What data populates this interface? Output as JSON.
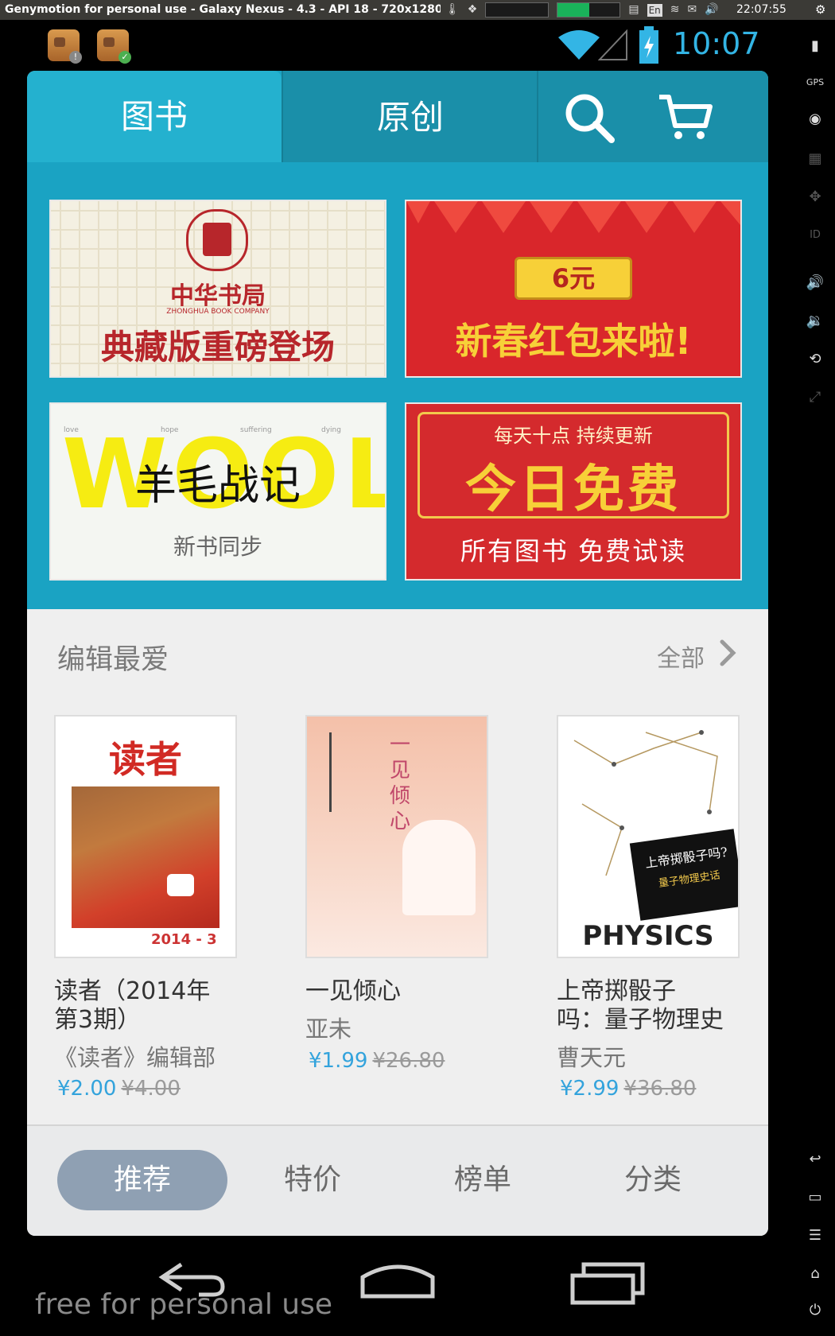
{
  "host": {
    "window_title": "Genymotion for personal use - Galaxy Nexus - 4.3 - API 18 - 720x1280 (720x128",
    "keyboard_layout": "En",
    "time": "22:07:55"
  },
  "status_bar": {
    "clock": "10:07",
    "accent_color": "#33b5e5"
  },
  "app": {
    "tabs": [
      {
        "label": "图书"
      },
      {
        "label": "原创"
      }
    ],
    "icons": {
      "search": "search-icon",
      "cart": "cart-icon"
    },
    "banners": {
      "zhonghua": {
        "logo": "中华书局",
        "logo_en": "ZHONGHUA BOOK COMPANY",
        "headline": "典藏版重磅登场"
      },
      "redpacket": {
        "ticket": "6元",
        "headline": "新春红包来啦!"
      },
      "wool": {
        "bg_word": "WOOL",
        "tiny_words": [
          "love",
          "hope",
          "suffering",
          "dying"
        ],
        "headline": "羊毛战记",
        "subline": "新书同步"
      },
      "free": {
        "top": "每天十点 持续更新",
        "headline": "今日免费",
        "bottom": "所有图书 免费试读"
      }
    },
    "editor_picks": {
      "title": "编辑最爱",
      "all_label": "全部",
      "books": [
        {
          "title_line1": "读者（2014年",
          "title_line2": "第3期）",
          "author": "《读者》编辑部",
          "price": "¥2.00",
          "old_price": "¥4.00",
          "cover_text": "读者",
          "cover_issue": "2014 - 3"
        },
        {
          "title_line1": "一见倾心",
          "title_line2": "",
          "author": "亚未",
          "price": "¥1.99",
          "old_price": "¥26.80",
          "cover_text": "一见倾心"
        },
        {
          "title_line1": "上帝掷骰子",
          "title_line2": "吗：量子物理史",
          "author": "曹天元",
          "price": "¥2.99",
          "old_price": "¥36.80",
          "cover_text": "上帝掷骰子吗?",
          "cover_sub": "量子物理史话",
          "cover_word": "PHYSICS"
        }
      ]
    },
    "bottom_nav": [
      {
        "label": "推荐",
        "active": true
      },
      {
        "label": "特价",
        "active": false
      },
      {
        "label": "榜单",
        "active": false
      },
      {
        "label": "分类",
        "active": false
      }
    ]
  },
  "watermark": "free for personal use",
  "colors": {
    "header": "#1aa3c3",
    "price": "#33a3dc",
    "nav_active": "#8fa0b3",
    "banner_red": "#d9262b"
  }
}
